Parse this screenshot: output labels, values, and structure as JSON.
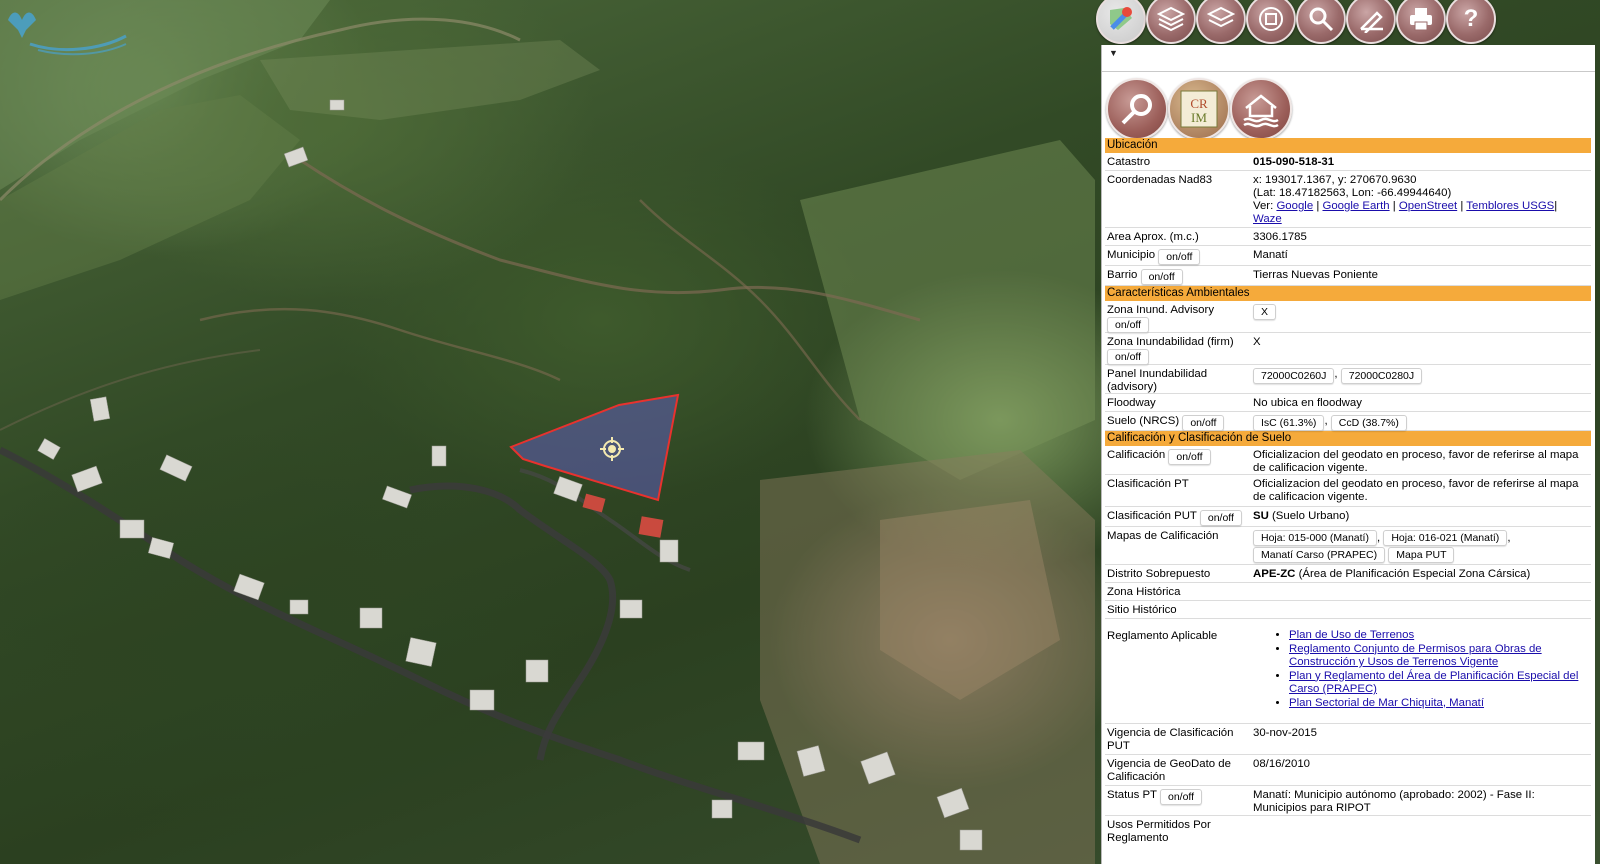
{
  "toolbar": {
    "tools": [
      {
        "name": "google-maps-icon"
      },
      {
        "name": "layers-icon"
      },
      {
        "name": "basemap-layers-icon"
      },
      {
        "name": "globe-coordinates-icon"
      },
      {
        "name": "search-icon"
      },
      {
        "name": "draw-measure-icon"
      },
      {
        "name": "print-icon"
      },
      {
        "name": "help-icon",
        "label": "?"
      }
    ]
  },
  "quick_icons": [
    {
      "name": "search-parcel-icon"
    },
    {
      "name": "crim-logo-icon",
      "label": "CRIM"
    },
    {
      "name": "flood-house-icon"
    }
  ],
  "panel": {
    "onoff": "on/off",
    "sections": {
      "ubicacion": "Ubicación",
      "ambientales": "Características Ambientales",
      "calificacion": "Calificación y Clasificación de Suelo"
    },
    "catastro": {
      "label": "Catastro",
      "value": "015-090-518-31"
    },
    "coordenadas": {
      "label": "Coordenadas Nad83",
      "xy": "x: 193017.1367, y: 270670.9630",
      "latlon": "(Lat: 18.47182563, Lon: -66.49944640)",
      "ver": "Ver:",
      "links": [
        "Google",
        "Google Earth",
        "OpenStreet",
        "Temblores USGS",
        "Waze"
      ],
      "sep": "|"
    },
    "area": {
      "label": "Area Aprox. (m.c.)",
      "value": "3306.1785"
    },
    "municipio": {
      "label": "Municipio",
      "value": "Manatí"
    },
    "barrio": {
      "label": "Barrio",
      "value": "Tierras Nuevas Poniente"
    },
    "zona_advisory": {
      "label": "Zona Inund. Advisory",
      "value": "X"
    },
    "zona_firm": {
      "label": "Zona Inundabilidad (firm)",
      "value": "X"
    },
    "panel_inund": {
      "label": "Panel Inundabilidad (advisory)",
      "values": [
        "72000C0260J",
        "72000C0280J"
      ],
      "sep": ","
    },
    "floodway": {
      "label": "Floodway",
      "value": "No ubica en floodway"
    },
    "suelo": {
      "label": "Suelo (NRCS)",
      "values": [
        "IsC (61.3%)",
        "CcD (38.7%)"
      ],
      "sep": ","
    },
    "calificacion": {
      "label": "Calificación",
      "value": "Oficializacion del geodato en proceso, favor de referirse al mapa de calificacion vigente."
    },
    "clasif_pt": {
      "label": "Clasificación PT",
      "value": "Oficializacion del geodato en proceso, favor de referirse al mapa de calificacion vigente."
    },
    "clasif_put": {
      "label": "Clasificación PUT",
      "code": "SU",
      "desc": "(Suelo Urbano)"
    },
    "mapas": {
      "label": "Mapas de Calificación",
      "values": [
        "Hoja: 015-000 (Manatí)",
        "Hoja: 016-021 (Manatí)",
        "Manatí Carso (PRAPEC)",
        "Mapa PUT"
      ],
      "sep": ","
    },
    "distrito": {
      "label": "Distrito Sobrepuesto",
      "code": "APE-ZC",
      "desc": "(Área de Planificación Especial Zona Cársica)"
    },
    "zona_hist": {
      "label": "Zona Histórica"
    },
    "sitio_hist": {
      "label": "Sitio Histórico"
    },
    "reglamento": {
      "label": "Reglamento Aplicable",
      "items": [
        "Plan de Uso de Terrenos",
        "Reglamento Conjunto de Permisos para Obras de Construcción y Usos de Terrenos Vigente",
        "Plan y Reglamento del Área de Planificación Especial del Carso (PRAPEC)",
        "Plan Sectorial de Mar Chiquita, Manatí"
      ]
    },
    "vigencia_put": {
      "label": "Vigencia de Clasificación PUT",
      "value": "30-nov-2015"
    },
    "vigencia_geo": {
      "label": "Vigencia de GeoDato de Calificación",
      "value": "08/16/2010"
    },
    "status_pt": {
      "label": "Status PT",
      "value": "Manatí: Municipio autónomo (aprobado: 2002) - Fase II: Municipios para RIPOT"
    },
    "usos": {
      "label": "Usos Permitidos Por Reglamento"
    }
  },
  "colors": {
    "section_header": "#f5aa3b",
    "parcel_fill": "#5b5aa8",
    "parcel_stroke": "#e8322e",
    "tool_button": "#9a6a6a",
    "link": "#1a0dab"
  }
}
